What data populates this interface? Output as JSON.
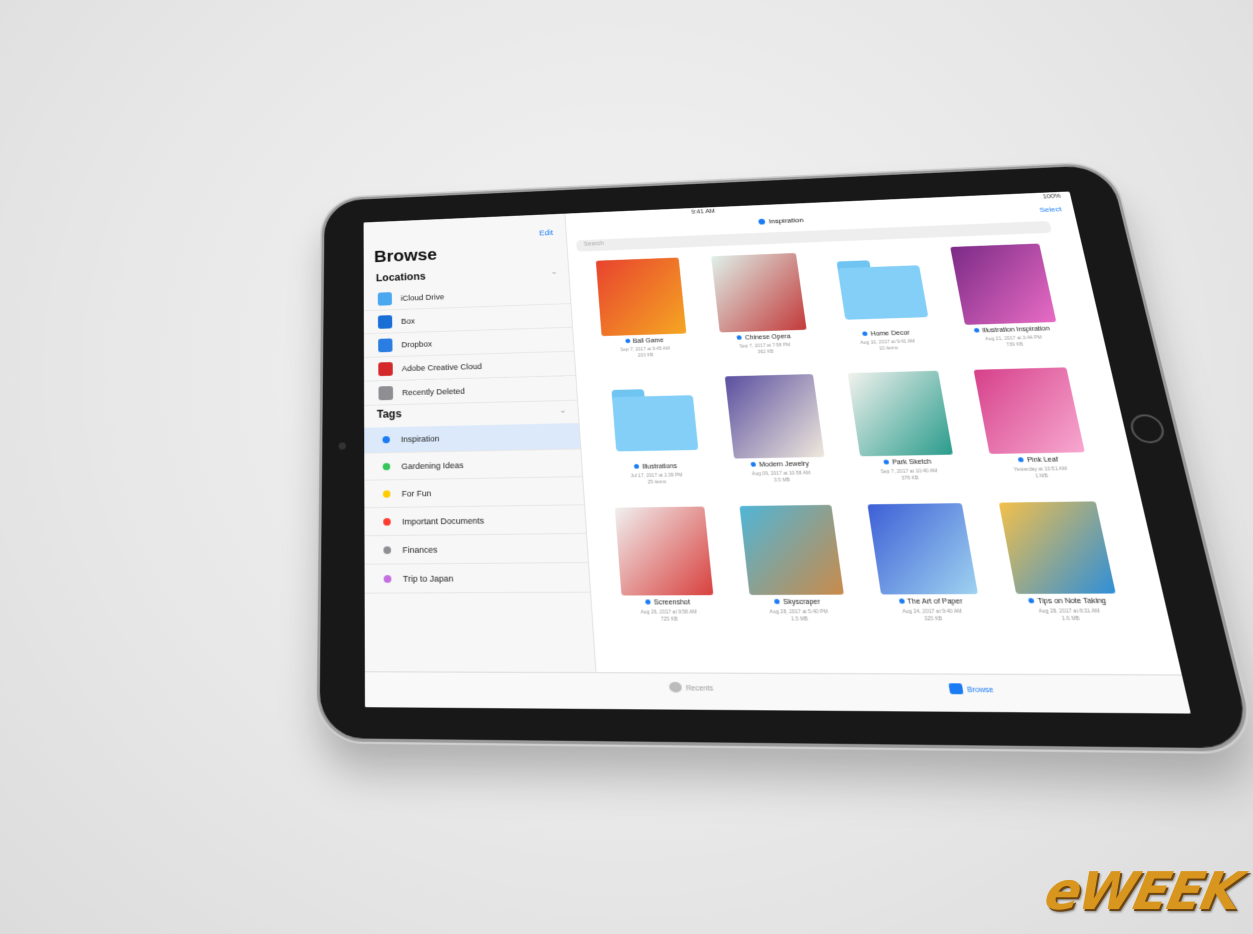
{
  "status": {
    "left": "iPad",
    "time": "9:41 AM",
    "right": "100%"
  },
  "sidebar": {
    "edit_label": "Edit",
    "title": "Browse",
    "locations_header": "Locations",
    "locations": [
      {
        "label": "iCloud Drive",
        "icon": "cloud-icon",
        "color": "#4aa8f0"
      },
      {
        "label": "Box",
        "icon": "box-icon",
        "color": "#1a6fd6"
      },
      {
        "label": "Dropbox",
        "icon": "dropbox-icon",
        "color": "#2a7de1"
      },
      {
        "label": "Adobe Creative Cloud",
        "icon": "creative-cloud-icon",
        "color": "#d4282b"
      },
      {
        "label": "Recently Deleted",
        "icon": "trash-icon",
        "color": "#8e8e93"
      }
    ],
    "tags_header": "Tags",
    "tags": [
      {
        "label": "Inspiration",
        "color": "#1a7cf5"
      },
      {
        "label": "Gardening Ideas",
        "color": "#34c759"
      },
      {
        "label": "For Fun",
        "color": "#ffcc00"
      },
      {
        "label": "Important Documents",
        "color": "#ff3b30"
      },
      {
        "label": "Finances",
        "color": "#8e8e93"
      },
      {
        "label": "Trip to Japan",
        "color": "#c46ee0"
      }
    ]
  },
  "main": {
    "title": "Inspiration",
    "select_label": "Select",
    "search_placeholder": "Search",
    "items": [
      {
        "name": "Ball Game",
        "date": "Sep 7, 2017 at 9:45 AM",
        "size": "203 KB",
        "kind": "image",
        "c1": "#e8432e",
        "c2": "#f5a623"
      },
      {
        "name": "Chinese Opera",
        "date": "Sep 7, 2017 at 7:58 PM",
        "size": "362 KB",
        "kind": "image",
        "c1": "#dff1ea",
        "c2": "#c23a3a"
      },
      {
        "name": "Home Decor",
        "date": "Aug 10, 2017 at 9:41 AM",
        "size": "10 items",
        "kind": "folder"
      },
      {
        "name": "Illustration Inspiration",
        "date": "Aug 21, 2017 at 3:44 PM",
        "size": "739 KB",
        "kind": "image",
        "c1": "#7a2a86",
        "c2": "#e86cc4"
      },
      {
        "name": "Illustrations",
        "date": "Jul 17, 2017 at 1:39 PM",
        "size": "25 items",
        "kind": "folder"
      },
      {
        "name": "Modern Jewelry",
        "date": "Aug 09, 2017 at 10:58 AM",
        "size": "3.5 MB",
        "kind": "image",
        "c1": "#5a4fa0",
        "c2": "#efe8dc"
      },
      {
        "name": "Park Sketch",
        "date": "Sep 7, 2017 at 10:40 AM",
        "size": "378 KB",
        "kind": "image",
        "c1": "#f2f2ee",
        "c2": "#2a9c8c"
      },
      {
        "name": "Pink Leaf",
        "date": "Yesterday at 10:51 AM",
        "size": "1 MB",
        "kind": "image",
        "c1": "#d6408a",
        "c2": "#f7a8d0"
      },
      {
        "name": "Screenshot",
        "date": "Aug 26, 2017 at 9:58 AM",
        "size": "725 KB",
        "kind": "image",
        "c1": "#f0f0f0",
        "c2": "#d8413e"
      },
      {
        "name": "Skyscraper",
        "date": "Aug 28, 2017 at 5:40 PM",
        "size": "1.5 MB",
        "kind": "image",
        "c1": "#4fb6d8",
        "c2": "#c98a4a"
      },
      {
        "name": "The Art of Paper",
        "date": "Aug 24, 2017 at 9:40 AM",
        "size": "325 KB",
        "kind": "image",
        "c1": "#3d5fd6",
        "c2": "#9fd2f0"
      },
      {
        "name": "Tips on Note Taking",
        "date": "Aug 28, 2017 at 8:31 AM",
        "size": "1.6 MB",
        "kind": "image",
        "c1": "#f4c04a",
        "c2": "#2f8fd8"
      }
    ]
  },
  "tabbar": {
    "recents_label": "Recents",
    "browse_label": "Browse"
  },
  "brand": {
    "logo_text": "eWEEK"
  }
}
